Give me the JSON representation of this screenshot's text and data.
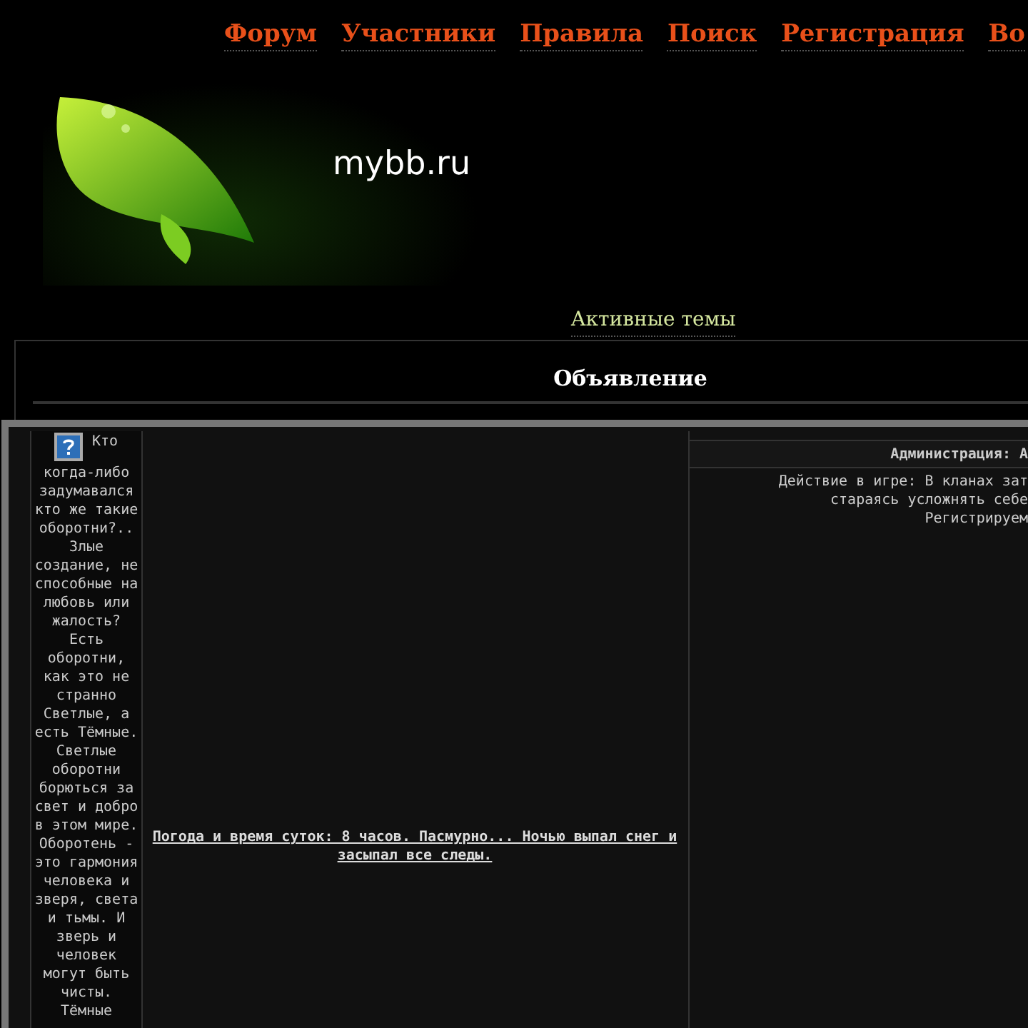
{
  "nav": [
    {
      "label": "Форум"
    },
    {
      "label": "Участники"
    },
    {
      "label": "Правила"
    },
    {
      "label": "Поиск"
    },
    {
      "label": "Регистрация"
    },
    {
      "label": "Во"
    }
  ],
  "logo": {
    "text": "mybb.ru"
  },
  "active_topics": "Активные темы",
  "announcement": {
    "title": "Объявление",
    "intro_first": "Кто",
    "intro": "когда-либо задумавался кто же такие оборотни?.. Злые создание, не способные на любовь или жалость? Есть оборотни, как это не странно Светлые, а есть Тёмные. Светлые оборотни борються за свет и добро в этом мире. Оборотень - это гармония человека и зверя, света и тьмы. И зверь и человек могут быть чисты. Тёмные",
    "weather": "Погода и время суток: 8 часов. Пасмурно... Ночью выпал снег и засыпал все следы.",
    "admin_heading": "Администрация: А",
    "game_lines": [
      "Действие в игре: В кланах зат",
      "стараясь усложнять себе",
      "Регистрируем"
    ]
  }
}
